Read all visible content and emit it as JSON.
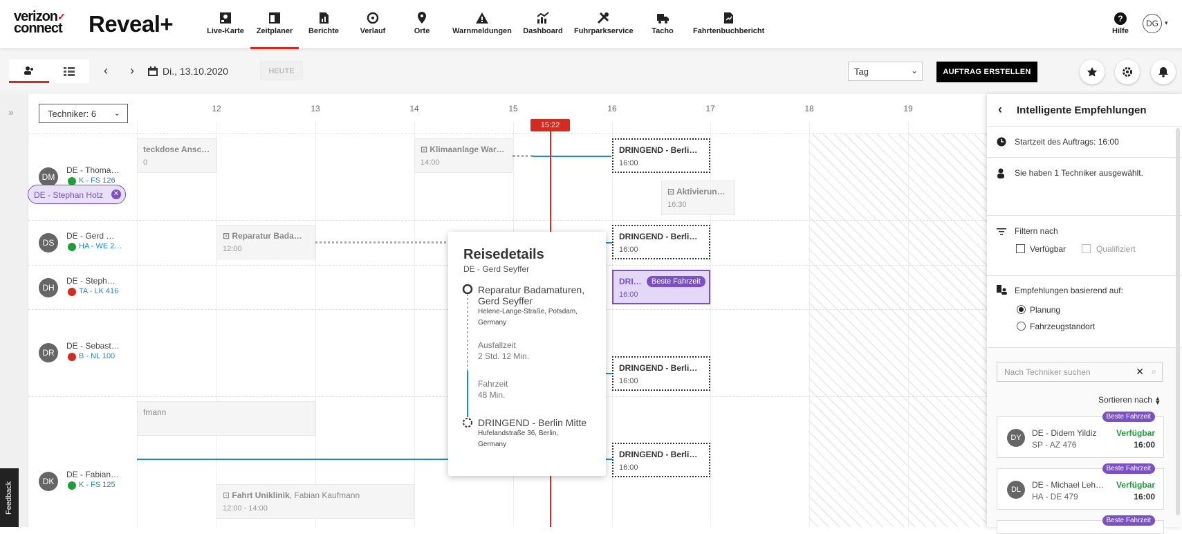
{
  "brand": {
    "vz_line1": "verizon",
    "vz_line2": "connect",
    "vz_check": "✓",
    "product": "Reveal+"
  },
  "nav": [
    {
      "label": "Live-Karte",
      "icon": "map-pin-grid-icon"
    },
    {
      "label": "Zeitplaner",
      "icon": "calendar-icon",
      "active": true
    },
    {
      "label": "Berichte",
      "icon": "report-icon"
    },
    {
      "label": "Verlauf",
      "icon": "history-icon"
    },
    {
      "label": "Orte",
      "icon": "location-icon"
    },
    {
      "label": "Warnmeldungen",
      "icon": "warning-icon"
    },
    {
      "label": "Dashboard",
      "icon": "dashboard-icon"
    },
    {
      "label": "Fuhrparkservice",
      "icon": "tools-icon"
    },
    {
      "label": "Tacho",
      "icon": "truck-icon"
    },
    {
      "label": "Fahrtenbuchbericht",
      "icon": "document-icon"
    }
  ],
  "help": {
    "label": "Hilfe",
    "icon_text": "?"
  },
  "user": {
    "initials": "DG"
  },
  "toolbar": {
    "date": "Di., 13.10.2020",
    "today": "HEUTE",
    "view": "Tag",
    "create": "AUFTRAG ERSTELLEN"
  },
  "feedback": "Feedback",
  "scheduler": {
    "technician_filter": "Techniker: 6",
    "now": "15:22",
    "hours": [
      "12",
      "13",
      "14",
      "15",
      "16",
      "17",
      "18",
      "19"
    ],
    "technicians": [
      {
        "initials": "DM",
        "name": "DE - Thoma…",
        "vehicle": "K - FS 126",
        "status": "green"
      },
      {
        "initials": "DS",
        "name": "DE - Gerd …",
        "vehicle": "HA - WE 2…",
        "status": "green"
      },
      {
        "initials": "DH",
        "name": "DE - Steph…",
        "vehicle": "TA - LK 416",
        "status": "red"
      },
      {
        "initials": "DR",
        "name": "DE - Sebast…",
        "vehicle": "B - NL 100",
        "status": "red"
      },
      {
        "initials": "DK",
        "name": "DE - Fabian…",
        "vehicle": "K - FS 125",
        "status": "green"
      }
    ],
    "jobs": {
      "j1": {
        "title": "teckdose Ansc…",
        "time": "0"
      },
      "j2": {
        "title": "Klimaanlage War…",
        "time": "14:00"
      },
      "j3": {
        "title": "Aktivierun…",
        "time": "16:30"
      },
      "j4": {
        "title": "Reparatur Bada…",
        "time": "12:00"
      },
      "j5": {
        "title": "fmann",
        "time": ""
      },
      "j6": {
        "title": "Fahrt Uniklinik",
        "title_rest": ", Fabian Kaufmann",
        "time": "12:00 - 14:00"
      }
    },
    "urgent": [
      {
        "title": "DRINGEND - Berli…",
        "time": "16:00"
      },
      {
        "title": "DRINGEND - Berli…",
        "time": "16:00"
      },
      {
        "title": "DRI…",
        "time": "16:00",
        "badge": "Beste Fahrzeit"
      },
      {
        "title": "DRINGEND - Berli…",
        "time": "16:00"
      },
      {
        "title": "DRINGEND - Berli…",
        "time": "16:00"
      }
    ]
  },
  "popup": {
    "title": "Reisedetails",
    "subtitle": "DE - Gerd Seyffer",
    "from_name": "Reparatur Badamaturen, Gerd Seyffer",
    "from_address": "Helene-Lange-Straße, Potsdam, Germany",
    "downtime_label": "Ausfallzeit",
    "downtime_value": "2 Std. 12 Min.",
    "travel_label": "Fahrzeit",
    "travel_value": "48 Min.",
    "to_name": "DRINGEND - Berlin Mitte",
    "to_address": "Hufelandstraße 36, Berlin, Germany"
  },
  "panel": {
    "title": "Intelligente Empfehlungen",
    "start_time": "Startzeit des Auftrags: 16:00",
    "selected": "Sie haben 1 Techniker ausgewählt.",
    "chip": "DE - Stephan Hotz",
    "filter_label": "Filtern nach",
    "filter_available": "Verfügbar",
    "filter_qualified": "Qualifiziert",
    "based_on": "Empfehlungen basierend auf:",
    "opt_planning": "Planung",
    "opt_location": "Fahrzeugstandort",
    "search_placeholder": "Nach Techniker suchen",
    "sort_label": "Sortieren nach",
    "cards": [
      {
        "initials": "DY",
        "name": "DE - Didem Yildiz",
        "vehicle": "SP - AZ 476",
        "availability": "Verfügbar",
        "time": "16:00",
        "badge": "Beste Fahrzeit"
      },
      {
        "initials": "DL",
        "name": "DE - Michael Leh…",
        "vehicle": "HA - DE 479",
        "availability": "Verfügbar",
        "time": "16:00",
        "badge": "Beste Fahrzeit"
      },
      {
        "badge": "Beste Fahrzeit"
      }
    ]
  }
}
